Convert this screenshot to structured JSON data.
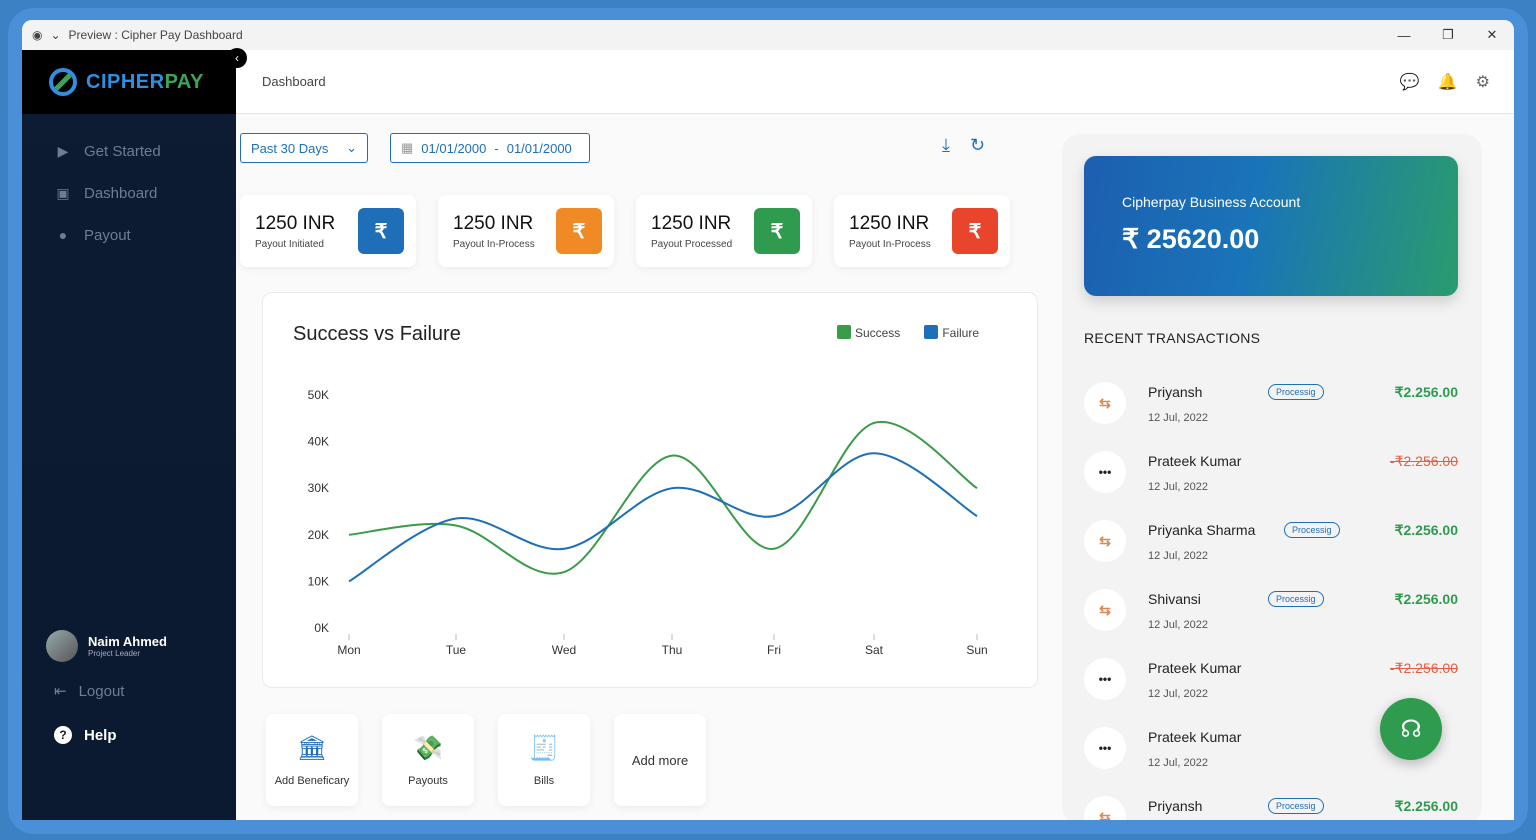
{
  "window": {
    "title": "Preview : Cipher Pay Dashboard",
    "minimize": "—",
    "maximize": "❐",
    "close": "✕"
  },
  "brand": {
    "part1": "CIPHER",
    "part2": "PAY"
  },
  "sidebar": {
    "items": [
      {
        "label": "Get Started",
        "icon": "play-icon"
      },
      {
        "label": "Dashboard",
        "icon": "monitor-icon"
      },
      {
        "label": "Payout",
        "icon": "coin-icon"
      }
    ],
    "user": {
      "name": "Naim Ahmed",
      "role": "Project Leader"
    },
    "logout": "Logout",
    "help": "Help"
  },
  "header": {
    "breadcrumb": "Dashboard"
  },
  "filters": {
    "period": "Past 30 Days",
    "date_from": "01/01/2000",
    "date_sep": "-",
    "date_to": "01/01/2000"
  },
  "stats": [
    {
      "amount": "1250 INR",
      "label": "Payout Initiated",
      "color": "#1e6fb8"
    },
    {
      "amount": "1250 INR",
      "label": "Payout In-Process",
      "color": "#f08a24"
    },
    {
      "amount": "1250 INR",
      "label": "Payout Processed",
      "color": "#2e9b4e"
    },
    {
      "amount": "1250 INR",
      "label": "Payout In-Process",
      "color": "#e8452c"
    }
  ],
  "chart_data": {
    "type": "line",
    "title": "Success vs Failure",
    "categories": [
      "Mon",
      "Tue",
      "Wed",
      "Thu",
      "Fri",
      "Sat",
      "Sun"
    ],
    "y_ticks": [
      "0K",
      "10K",
      "20K",
      "30K",
      "40K",
      "50K"
    ],
    "ylim": [
      0,
      50000
    ],
    "legend_position": "top-right",
    "series": [
      {
        "name": "Success",
        "color": "#3a9b48",
        "values": [
          20000,
          22000,
          12000,
          37000,
          17000,
          44000,
          30000
        ]
      },
      {
        "name": "Failure",
        "color": "#1e6fb8",
        "values": [
          10000,
          23500,
          17000,
          30000,
          24000,
          37500,
          24000
        ]
      }
    ]
  },
  "quick_actions": [
    {
      "label": "Add Beneficary",
      "icon": "bank-icon"
    },
    {
      "label": "Payouts",
      "icon": "hand-coin-icon"
    },
    {
      "label": "Bills",
      "icon": "bill-icon"
    },
    {
      "label": "Add more"
    }
  ],
  "account": {
    "name": "Cipherpay Business Account",
    "balance": "₹ 25620.00"
  },
  "recent": {
    "title": "RECENT TRANSACTIONS",
    "items": [
      {
        "name": "Priyansh",
        "status": "Processig",
        "date": "12 Jul, 2022",
        "amount": "₹2.256.00",
        "kind": "pos"
      },
      {
        "name": "Prateek Kumar",
        "status": "",
        "date": "12 Jul, 2022",
        "amount": "-₹2.256.00",
        "kind": "neg"
      },
      {
        "name": "Priyanka Sharma",
        "status": "Processig",
        "date": "12 Jul, 2022",
        "amount": "₹2.256.00",
        "kind": "pos"
      },
      {
        "name": "Shivansi",
        "status": "Processig",
        "date": "12 Jul, 2022",
        "amount": "₹2.256.00",
        "kind": "pos"
      },
      {
        "name": "Prateek Kumar",
        "status": "",
        "date": "12 Jul, 2022",
        "amount": "-₹2.256.00",
        "kind": "neg"
      },
      {
        "name": "Prateek Kumar",
        "status": "",
        "date": "12 Jul, 2022",
        "amount": "",
        "kind": "neg"
      },
      {
        "name": "Priyansh",
        "status": "Processig",
        "date": "",
        "amount": "₹2.256.00",
        "kind": "pos"
      }
    ]
  }
}
